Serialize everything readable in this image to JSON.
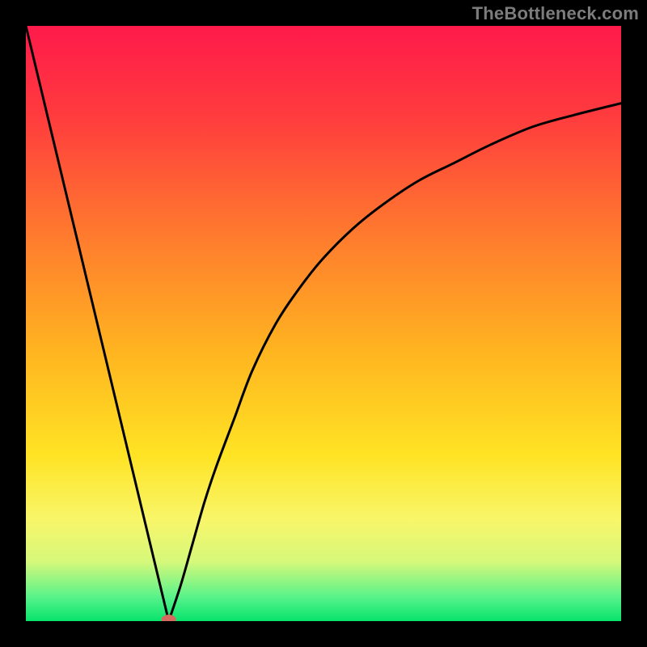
{
  "watermark": "TheBottleneck.com",
  "chart_data": {
    "type": "line",
    "title": "",
    "xlabel": "",
    "ylabel": "",
    "xlim": [
      0,
      100
    ],
    "ylim": [
      0,
      100
    ],
    "grid": false,
    "legend": "none",
    "background_gradient": {
      "type": "vertical",
      "stops": [
        {
          "y_pct": 0,
          "color": "#ff1a4b"
        },
        {
          "y_pct": 15,
          "color": "#ff3b3e"
        },
        {
          "y_pct": 35,
          "color": "#ff7a2e"
        },
        {
          "y_pct": 55,
          "color": "#ffb520"
        },
        {
          "y_pct": 72,
          "color": "#ffe324"
        },
        {
          "y_pct": 83,
          "color": "#f8f66a"
        },
        {
          "y_pct": 90,
          "color": "#d6f87a"
        },
        {
          "y_pct": 96,
          "color": "#57f38a"
        },
        {
          "y_pct": 100,
          "color": "#07e36c"
        }
      ]
    },
    "series": [
      {
        "name": "left-segment",
        "stroke": "#000000",
        "x": [
          0,
          24
        ],
        "y": [
          100,
          0
        ]
      },
      {
        "name": "right-curve",
        "stroke": "#000000",
        "x": [
          24,
          26,
          28,
          30,
          32,
          35,
          38,
          42,
          46,
          50,
          55,
          60,
          66,
          72,
          78,
          85,
          92,
          100
        ],
        "y": [
          0,
          6,
          13,
          20,
          26,
          34,
          42,
          50,
          56,
          61,
          66,
          70,
          74,
          77,
          80,
          83,
          85,
          87
        ]
      }
    ],
    "marker": {
      "name": "min-marker",
      "x": 24,
      "y": 0,
      "color": "#d66a5f",
      "rx": 9,
      "ry": 6
    }
  }
}
